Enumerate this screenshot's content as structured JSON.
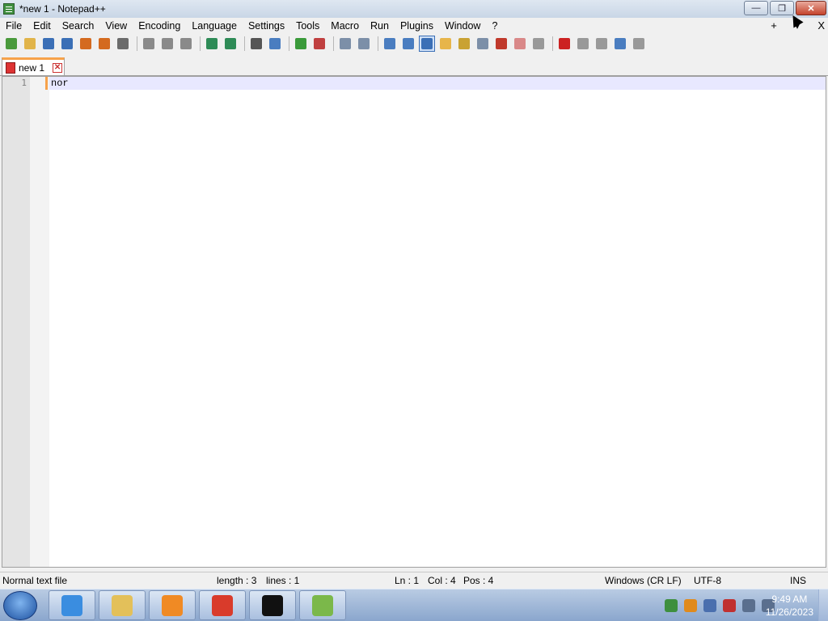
{
  "window": {
    "title": "*new 1 - Notepad++",
    "controls": {
      "minimize": "—",
      "restore": "❐",
      "close": "✕"
    }
  },
  "menu": {
    "items": [
      "File",
      "Edit",
      "Search",
      "View",
      "Encoding",
      "Language",
      "Settings",
      "Tools",
      "Macro",
      "Run",
      "Plugins",
      "Window",
      "?"
    ],
    "right": {
      "plus": "+",
      "arrow": "▾",
      "close": "X"
    }
  },
  "toolbar": {
    "buttons": [
      {
        "icon": "new-file-icon",
        "color": "#4a9a3c"
      },
      {
        "icon": "open-file-icon",
        "color": "#e1b44a"
      },
      {
        "icon": "save-icon",
        "color": "#3b6fb6"
      },
      {
        "icon": "save-all-icon",
        "color": "#3b6fb6"
      },
      {
        "icon": "close-icon",
        "color": "#d46a1f"
      },
      {
        "icon": "close-all-icon",
        "color": "#d46a1f"
      },
      {
        "icon": "print-icon",
        "color": "#6b6b6b"
      },
      {
        "sep": true
      },
      {
        "icon": "cut-icon",
        "color": "#8a8a8a"
      },
      {
        "icon": "copy-icon",
        "color": "#8a8a8a"
      },
      {
        "icon": "paste-icon",
        "color": "#8a8a8a"
      },
      {
        "sep": true
      },
      {
        "icon": "undo-icon",
        "color": "#2e8b57"
      },
      {
        "icon": "redo-icon",
        "color": "#2e8b57"
      },
      {
        "sep": true
      },
      {
        "icon": "find-icon",
        "color": "#555555"
      },
      {
        "icon": "replace-icon",
        "color": "#4a7dc0"
      },
      {
        "sep": true
      },
      {
        "icon": "zoom-in-icon",
        "color": "#3a9a3a"
      },
      {
        "icon": "zoom-out-icon",
        "color": "#c04040"
      },
      {
        "sep": true
      },
      {
        "icon": "sync-vertical-icon",
        "color": "#7c8fa8"
      },
      {
        "icon": "sync-horizontal-icon",
        "color": "#7c8fa8"
      },
      {
        "sep": true
      },
      {
        "icon": "word-wrap-icon",
        "color": "#4a7dc0"
      },
      {
        "icon": "show-all-chars-icon",
        "color": "#4a7dc0"
      },
      {
        "icon": "indent-guide-icon",
        "color": "#3b6fb6",
        "active": true
      },
      {
        "icon": "user-lang-icon",
        "color": "#e7b54a"
      },
      {
        "icon": "doc-map-icon",
        "color": "#c9a233"
      },
      {
        "icon": "function-list-icon",
        "color": "#7c8fa8"
      },
      {
        "icon": "folder-workspace-icon",
        "color": "#c0392b"
      },
      {
        "icon": "doc-list-icon",
        "color": "#d98888"
      },
      {
        "icon": "monitoring-icon",
        "color": "#999999"
      },
      {
        "sep": true
      },
      {
        "icon": "record-macro-icon",
        "color": "#cc2222"
      },
      {
        "icon": "stop-macro-icon",
        "color": "#999999"
      },
      {
        "icon": "play-macro-icon",
        "color": "#999999"
      },
      {
        "icon": "run-macro-multiple-icon",
        "color": "#4a7dc0"
      },
      {
        "icon": "save-macro-icon",
        "color": "#999999"
      }
    ]
  },
  "tabs": [
    {
      "label": "new 1",
      "close": "✕"
    }
  ],
  "editor": {
    "line_number": "1",
    "text": "nor"
  },
  "status": {
    "file_type": "Normal text file",
    "length": "length : 3",
    "lines": "lines : 1",
    "ln": "Ln : 1",
    "col": "Col : 4",
    "pos": "Pos : 4",
    "eol": "Windows (CR LF)",
    "encoding": "UTF-8",
    "mode": "INS"
  },
  "taskbar": {
    "apps": [
      {
        "icon": "internet-explorer-icon",
        "color": "#3a8de0"
      },
      {
        "icon": "file-explorer-icon",
        "color": "#e3c05a"
      },
      {
        "icon": "media-player-icon",
        "color": "#f08a24"
      },
      {
        "icon": "chrome-icon",
        "color": "#d93b2b"
      },
      {
        "icon": "command-prompt-icon",
        "color": "#111111"
      },
      {
        "icon": "notepad-plus-plus-icon",
        "color": "#7bb84a"
      }
    ],
    "tray_icons": [
      {
        "icon": "network-globe-icon",
        "color": "#3e8f3e"
      },
      {
        "icon": "search-tray-icon",
        "color": "#e08a1c"
      },
      {
        "icon": "action-center-icon",
        "color": "#4a6fae"
      },
      {
        "icon": "flag-error-icon",
        "color": "#c03030"
      },
      {
        "icon": "network-icon",
        "color": "#5a6f8e"
      },
      {
        "icon": "volume-muted-icon",
        "color": "#5a6f8e"
      }
    ],
    "time": "9:49 AM",
    "date": "11/26/2023"
  }
}
